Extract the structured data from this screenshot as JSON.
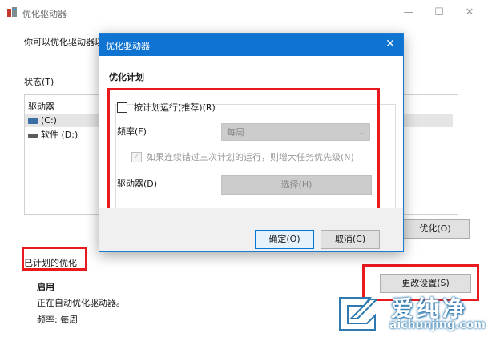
{
  "background_window": {
    "title": "优化驱动器",
    "description": "你可以优化驱动器以",
    "status_label": "状态(T)",
    "list_header": "驱动器",
    "drives": [
      {
        "label": "(C:)",
        "selected": true
      },
      {
        "label": "软件 (D:)",
        "selected": false
      }
    ],
    "optimize_button": "优化(O)",
    "scheduled_title": "已计划的优化",
    "status_enabled": "启用",
    "status_auto": "正在自动优化驱动器。",
    "frequency_text": "频率: 每周",
    "change_settings_button": "更改设置(S)",
    "window_buttons": {
      "minimize": "—",
      "maximize": "☐",
      "close": "✕"
    }
  },
  "dialog": {
    "title": "优化驱动器",
    "close_glyph": "✕",
    "section_title": "优化计划",
    "schedule_checkbox_label": "按计划运行(推荐)(R)",
    "schedule_checked": false,
    "frequency_label": "频率(F)",
    "frequency_value": "每周",
    "notify_label": "如果连续错过三次计划的运行，则增大任务优先级(N)",
    "notify_checked": true,
    "drives_label": "驱动器(D)",
    "choose_button": "选择(H)",
    "ok_button": "确定(O)",
    "cancel_button": "取消(C)"
  },
  "watermark": {
    "name": "爱纯净",
    "url": "aichunjing.com"
  },
  "colors": {
    "accent": "#0f73d1",
    "highlight": "#e8191f"
  }
}
